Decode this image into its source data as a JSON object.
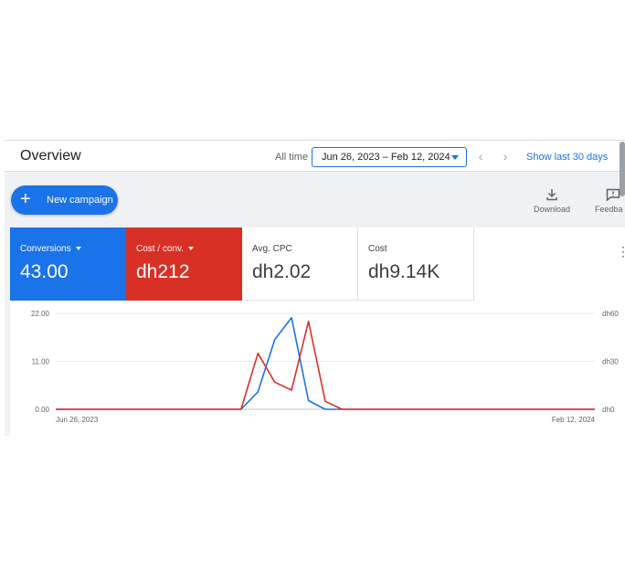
{
  "header": {
    "title": "Overview",
    "all_time_label": "All time",
    "date_range": "Jun 26, 2023 – Feb 12, 2024",
    "prev_label": "‹",
    "next_label": "›",
    "show_last_label": "Show last 30 days"
  },
  "actions": {
    "new_campaign_label": "New campaign",
    "download_label": "Download",
    "feedback_label": "Feedba"
  },
  "metrics": [
    {
      "label": "Conversions",
      "value": "43.00",
      "color": "#1a73e8"
    },
    {
      "label": "Cost / conv.",
      "value": "dh212",
      "color": "#d93025"
    },
    {
      "label": "Avg. CPC",
      "value": "dh2.02"
    },
    {
      "label": "Cost",
      "value": "dh9.14K"
    }
  ],
  "colors": {
    "accent": "#1a73e8",
    "red": "#d93025"
  },
  "chart_data": {
    "type": "line",
    "x_labels": [
      "Jun 26, 2023",
      "Feb 12, 2024"
    ],
    "y_left_ticks": [
      "22.00",
      "11.00",
      "0.00"
    ],
    "y_right_ticks": [
      "dh60",
      "dh30",
      "dh0"
    ],
    "ylim": [
      0,
      22
    ],
    "y2lim": [
      0,
      60
    ],
    "grid": true,
    "x_index": [
      0,
      11,
      12,
      13,
      14,
      15,
      16,
      17,
      18,
      32
    ],
    "series": [
      {
        "name": "Conversions",
        "color": "#1a73e8",
        "axis": "left",
        "values": [
          0,
          0,
          4,
          16,
          21,
          2,
          0,
          0,
          0,
          0
        ]
      },
      {
        "name": "Cost / conv.",
        "color": "#d93025",
        "axis": "right",
        "values": [
          0,
          0,
          35,
          17,
          12,
          55,
          5,
          0,
          0,
          0
        ]
      }
    ]
  }
}
